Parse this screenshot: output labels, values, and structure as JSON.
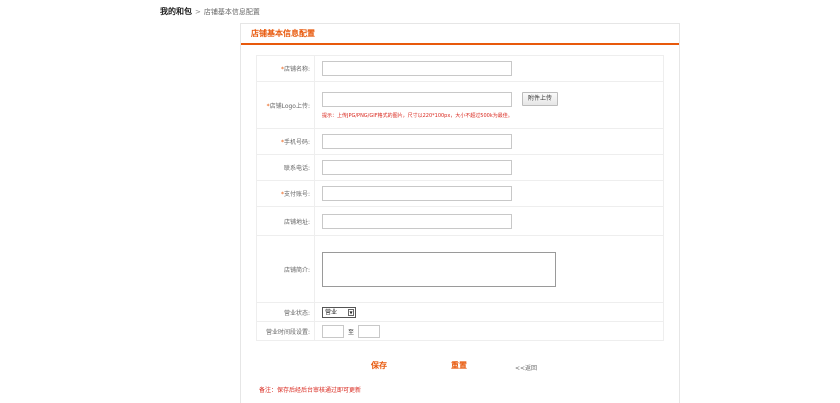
{
  "breadcrumb": {
    "home": "我的和包",
    "separator": ">",
    "current": "店铺基本信息配置"
  },
  "panel": {
    "title": "店铺基本信息配置"
  },
  "form": {
    "shop_name": {
      "required": "*",
      "label": "店铺名称:",
      "value": ""
    },
    "logo": {
      "required": "*",
      "label": "店铺Logo上传:",
      "value": "",
      "upload_label": "附件上传",
      "hint": "提示：上传JPG/PNG/GIF格式的图片，尺寸以220*100px，大小不超过500k为最佳。"
    },
    "phone": {
      "required": "*",
      "label": "手机号码:",
      "value": ""
    },
    "contact": {
      "label": "联系电话:",
      "value": ""
    },
    "pay_account": {
      "required": "*",
      "label": "支付账号:",
      "value": ""
    },
    "address": {
      "label": "店铺地址:",
      "value": ""
    },
    "intro": {
      "label": "店铺简介:",
      "value": ""
    },
    "status": {
      "label": "营业状态:",
      "value": "营业"
    },
    "hours": {
      "label": "营业时间段设置:",
      "to": "至",
      "start": "",
      "end": ""
    }
  },
  "actions": {
    "save": "保存",
    "reset": "重置",
    "back": "<<返回"
  },
  "remark": "备注：保存后经后台审核通过即可更新"
}
